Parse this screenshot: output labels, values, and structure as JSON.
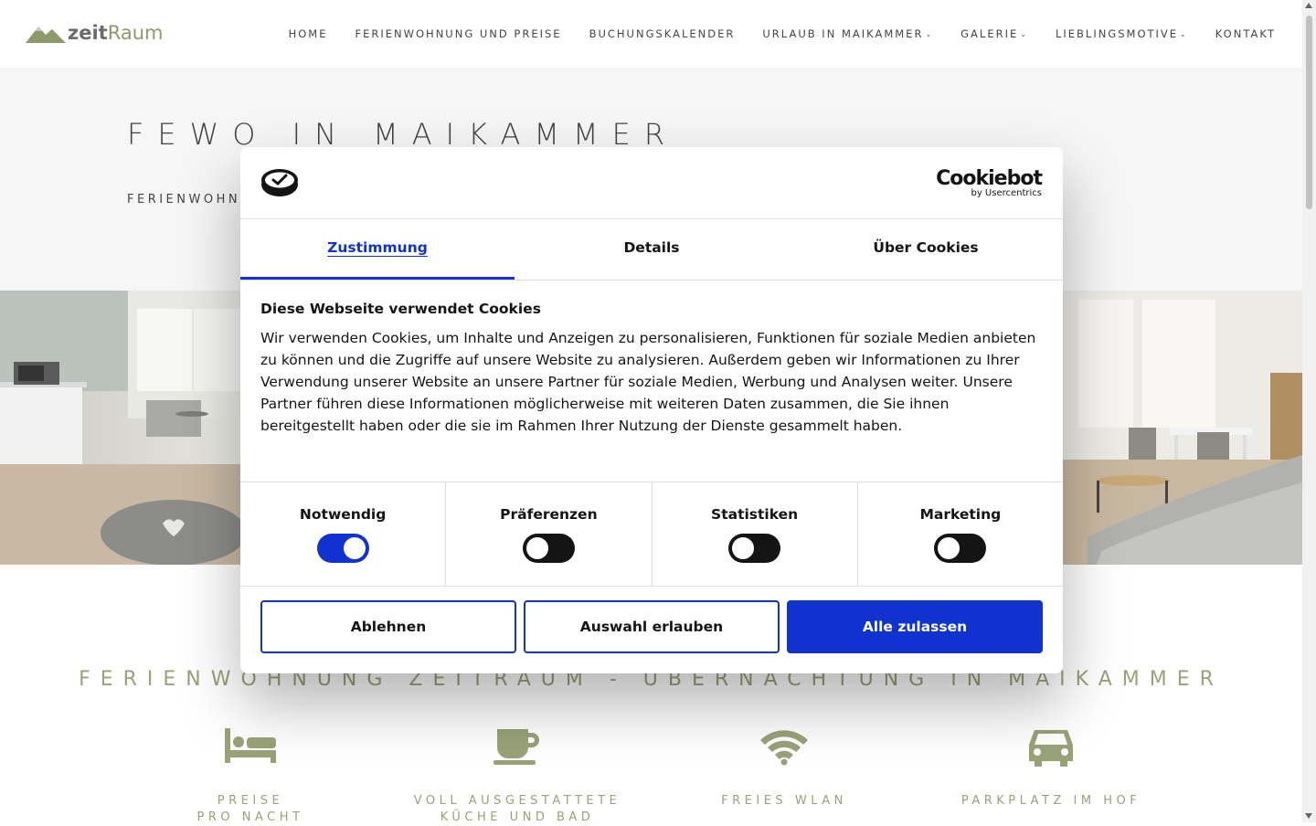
{
  "header": {
    "logo": {
      "part1": "zeit",
      "part2": "Raum"
    },
    "nav": [
      {
        "label": "HOME",
        "dropdown": false
      },
      {
        "label": "FERIENWOHNUNG UND PREISE",
        "dropdown": false
      },
      {
        "label": "BUCHUNGSKALENDER",
        "dropdown": false
      },
      {
        "label": "URLAUB IN MAIKAMMER",
        "dropdown": true
      },
      {
        "label": "GALERIE",
        "dropdown": true
      },
      {
        "label": "LIEBLINGSMOTIVE",
        "dropdown": true
      },
      {
        "label": "KONTAKT",
        "dropdown": false
      }
    ]
  },
  "hero": {
    "title": "FEWO IN MAIKAMMER",
    "subtitle": "FERIENWOHNUN"
  },
  "section": {
    "heading": "FERIENWOHNUNG ZEITRAUM - ÜBERNACHTUNG IN MAIKAMMER",
    "features": [
      {
        "icon": "bed-icon",
        "label": "PREISE\nPRO NACHT"
      },
      {
        "icon": "coffee-cup-icon",
        "label": "VOLL AUSGESTATTETE\nKÜCHE UND BAD"
      },
      {
        "icon": "wifi-icon",
        "label": "FREIES WLAN"
      },
      {
        "icon": "car-icon",
        "label": "PARKPLATZ IM HOF"
      }
    ]
  },
  "cookie": {
    "brand": "Cookiebot",
    "brand_by": "by Usercentrics",
    "tabs": [
      {
        "label": "Zustimmung",
        "active": true
      },
      {
        "label": "Details",
        "active": false
      },
      {
        "label": "Über Cookies",
        "active": false
      }
    ],
    "title": "Diese Webseite verwendet Cookies",
    "text": "Wir verwenden Cookies, um Inhalte und Anzeigen zu personalisieren, Funktionen für soziale Medien anbieten zu können und die Zugriffe auf unsere Website zu analysieren. Außerdem geben wir Informationen zu Ihrer Verwendung unserer Website an unsere Partner für soziale Medien, Werbung und Analysen weiter. Unsere Partner führen diese Informationen möglicherweise mit weiteren Daten zusammen, die Sie ihnen bereitgestellt haben oder die sie im Rahmen Ihrer Nutzung der Dienste gesammelt haben.",
    "categories": [
      {
        "label": "Notwendig",
        "enabled": true
      },
      {
        "label": "Präferenzen",
        "enabled": false
      },
      {
        "label": "Statistiken",
        "enabled": false
      },
      {
        "label": "Marketing",
        "enabled": false
      }
    ],
    "buttons": {
      "decline": "Ablehnen",
      "allow_selection": "Auswahl erlauben",
      "allow_all": "Alle zulassen"
    }
  },
  "colors": {
    "accent": "#1032cf",
    "brand_green": "#8e9a6a",
    "feature_green": "#9aa277"
  }
}
